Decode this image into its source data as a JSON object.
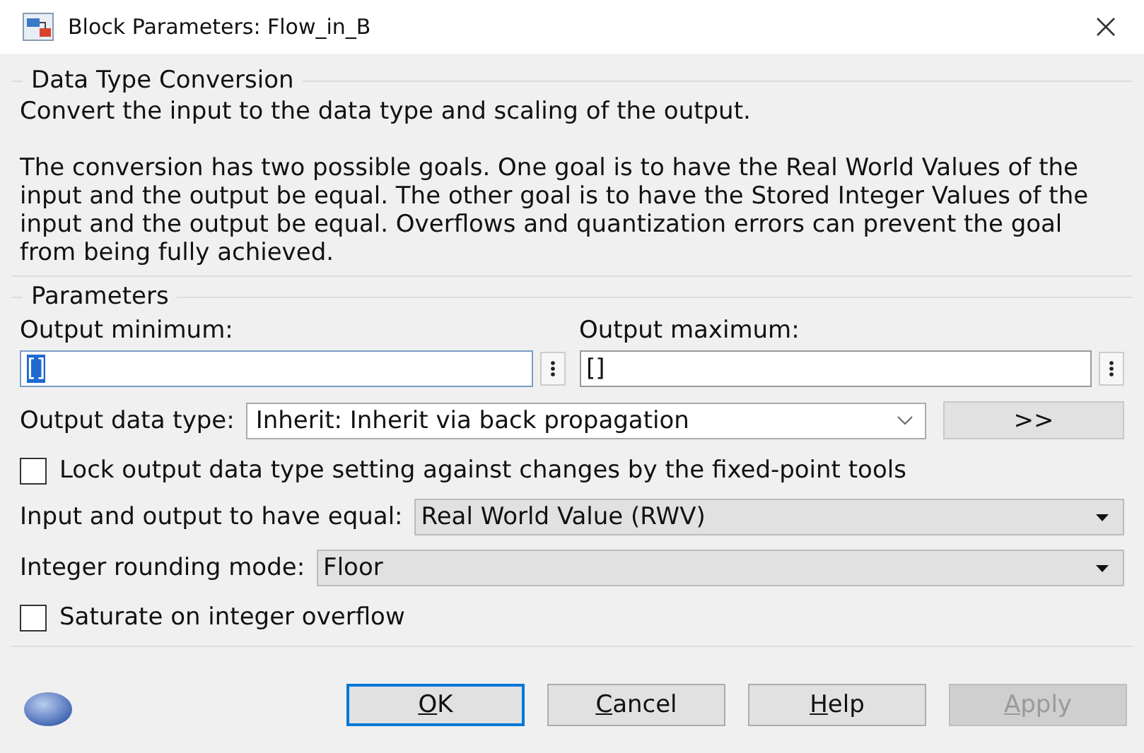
{
  "window": {
    "title": "Block Parameters: Flow_in_B"
  },
  "description": {
    "title": "Data Type Conversion",
    "paragraphs": [
      "Convert the input to the data type and scaling of the output.",
      "The conversion has two possible goals. One goal is to have the Real World Values of the input and the output be equal.  The other goal is to have the Stored Integer Values of the input and the output be equal. Overflows and quantization errors can prevent the goal from being fully achieved."
    ]
  },
  "parameters": {
    "title": "Parameters",
    "output_minimum": {
      "label": "Output minimum:",
      "value": "[]",
      "selected": true
    },
    "output_maximum": {
      "label": "Output maximum:",
      "value": "[]",
      "selected": false
    },
    "output_data_type": {
      "label": "Output data type:",
      "value": "Inherit: Inherit via back propagation",
      "button": ">>"
    },
    "lock_output": {
      "label": "Lock output data type setting against changes by the fixed-point tools",
      "checked": false
    },
    "input_output_equal": {
      "label": "Input and output to have equal:",
      "value": "Real World Value (RWV)"
    },
    "rounding_mode": {
      "label": "Integer rounding mode:",
      "value": "Floor"
    },
    "saturate": {
      "label": "Saturate on integer overflow",
      "checked": false
    }
  },
  "buttons": [
    {
      "label": "OK",
      "default": true,
      "disabled": false
    },
    {
      "label": "Cancel",
      "default": false,
      "disabled": false
    },
    {
      "label": "Help",
      "default": false,
      "disabled": false
    },
    {
      "label": "Apply",
      "default": false,
      "disabled": true
    }
  ]
}
